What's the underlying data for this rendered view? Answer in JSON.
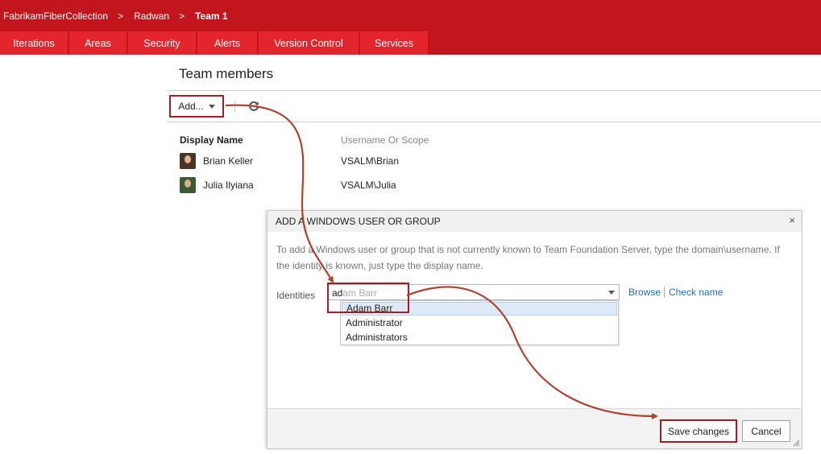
{
  "breadcrumb": {
    "collection": "FabrikamFiberCollection",
    "separator": ">",
    "project": "Radwan",
    "team": "Team 1"
  },
  "tabs": [
    {
      "label": "Iterations"
    },
    {
      "label": "Areas"
    },
    {
      "label": "Security"
    },
    {
      "label": "Alerts"
    },
    {
      "label": "Version Control"
    },
    {
      "label": "Services"
    }
  ],
  "section": {
    "title": "Team members"
  },
  "toolbar": {
    "add_label": "Add...",
    "refresh_icon": "refresh-icon"
  },
  "members_table": {
    "columns": {
      "display_name": "Display Name",
      "scope": "Username Or Scope"
    },
    "rows": [
      {
        "name": "Brian Keller",
        "username": "VSALM\\Brian"
      },
      {
        "name": "Julia Ilyiana",
        "username": "VSALM\\Julia"
      }
    ]
  },
  "dialog": {
    "title": "ADD A WINDOWS USER OR GROUP",
    "close": "×",
    "description": "To add a Windows user or group that is not currently known to Team Foundation Server, type the domain\\username. If the identity is known, just type the display name.",
    "identities_label": "Identities",
    "input_typed": "ad",
    "input_completion": "am Barr",
    "browse_label": "Browse",
    "check_name_label": "Check name",
    "suggestions": [
      "Adam Barr",
      "Administrator",
      "Administrators"
    ],
    "save_label": "Save changes",
    "cancel_label": "Cancel"
  },
  "colors": {
    "header_bg": "#c1161d",
    "tab_bg": "#e3262e",
    "highlight_border": "#a41d20",
    "link": "#1a6fc9",
    "annotation_arrow": "#b0422d"
  }
}
